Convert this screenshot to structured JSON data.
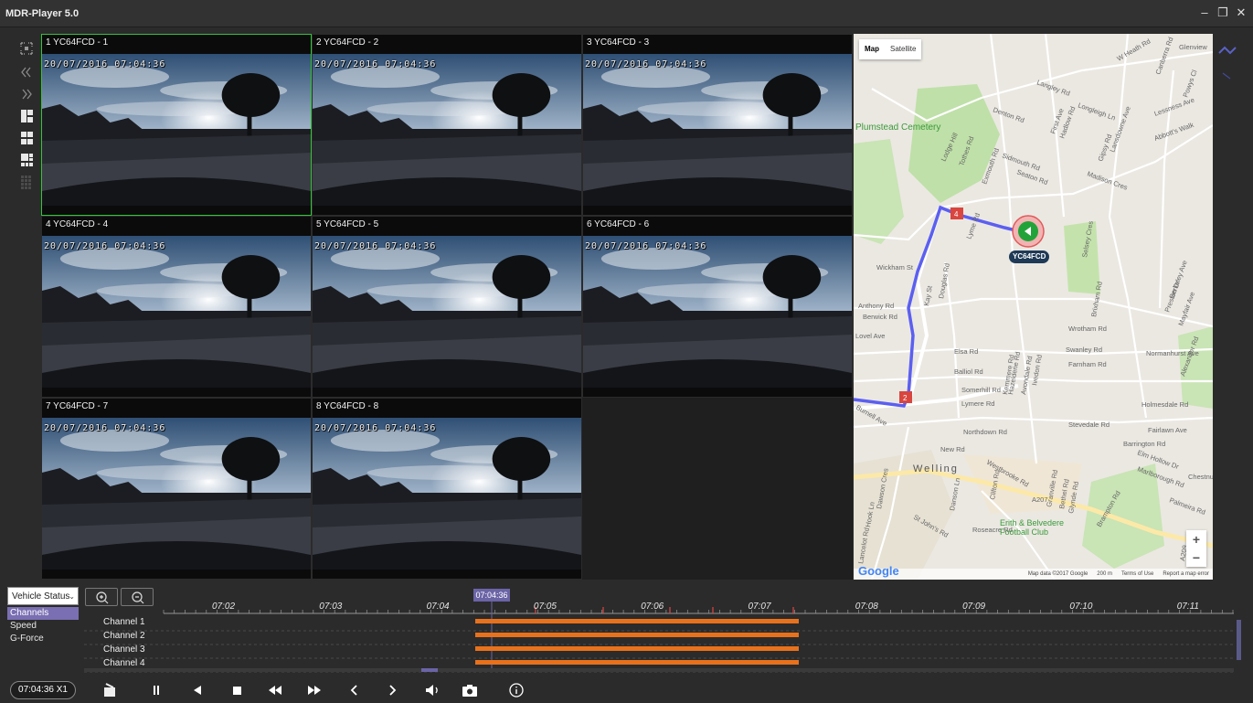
{
  "app": {
    "title": "MDR-Player 5.0",
    "window_controls": [
      "minimize",
      "restore",
      "close"
    ]
  },
  "left_toolbar": [
    "fullscreen-icon",
    "collapse-left-icon",
    "expand-right-icon",
    "layout-4-icon",
    "layout-4-alt-icon",
    "layout-9-icon",
    "layout-16-icon"
  ],
  "channels_grid": [
    {
      "caption": "1 YC64FCD - 1",
      "timestamp": "20/07/2016 07:04:36"
    },
    {
      "caption": "2 YC64FCD - 2",
      "timestamp": "20/07/2016 07:04:36"
    },
    {
      "caption": "3 YC64FCD - 3",
      "timestamp": "20/07/2016 07:04:36"
    },
    {
      "caption": "4 YC64FCD - 4",
      "timestamp": "20/07/2016 07:04:36"
    },
    {
      "caption": "5 YC64FCD - 5",
      "timestamp": "20/07/2016 07:04:36"
    },
    {
      "caption": "6 YC64FCD - 6",
      "timestamp": "20/07/2016 07:04:36"
    },
    {
      "caption": "7 YC64FCD - 7",
      "timestamp": "20/07/2016 07:04:36"
    },
    {
      "caption": "8 YC64FCD - 8",
      "timestamp": "20/07/2016 07:04:36"
    }
  ],
  "map": {
    "type_buttons": [
      "Map",
      "Satellite"
    ],
    "vehicle_label": "YC64FCD",
    "markers": [
      "4",
      "2"
    ],
    "places": {
      "cemetery": "Plumstead Cemetery",
      "welling": "Welling",
      "football": "Erith & Belvedere Football Club",
      "roads": [
        "Lodge Hill",
        "Wickham St",
        "Anthony Rd",
        "Berwick Rd",
        "Lovel Ave",
        "Elsa Rd",
        "Balliol Rd",
        "Somerhill Rd",
        "Lymere Rd",
        "Burnell Ave",
        "Northdown Rd",
        "New Rd",
        "Westbrooke Rd",
        "Wrotham Rd",
        "Swanley Rd",
        "Farnham Rd",
        "Stevedale Rd",
        "Fairlawn Ave",
        "Holmesdale Rd",
        "Barrington Rd",
        "Madison Cres",
        "Denton Rd",
        "Langley Rd",
        "Sidmouth Rd",
        "Seaton Rd",
        "Exmouth Rd",
        "Tothes Rd",
        "Lyme Rd",
        "Douglas Rd",
        "Kay St",
        "Clifton Rd",
        "Dawson Cres",
        "St John's Rd",
        "Danson Ln",
        "Roseacre Rd",
        "Granville Rd",
        "Bethel Rd",
        "Glynde Rd",
        "Palmeira Rd",
        "Marlborough Rd",
        "Elm Hollow Dr",
        "Brampton Rd",
        "A207",
        "Preston Dr",
        "Berkeley Ave",
        "Mayfair Ave",
        "Normanhurst Ave",
        "Alexander Rd",
        "Selsey Cres",
        "Brixham Rd",
        "Gipsy Rd",
        "Lansdowne Ave",
        "First Ave",
        "Hadlow Rd",
        "Longleigh Ln",
        "W Heath Rd",
        "Canberra Rd",
        "Lessness Ave",
        "Abbott's Walk",
        "Powys Cl",
        "Glenview",
        "Chestnut",
        "Hook Ln",
        "Lancelot Rd",
        "Kemmere Rd",
        "Hazeldene Rd",
        "Avondale Rd",
        "Ivedon Rd",
        "A209"
      ]
    },
    "zoom": [
      "+",
      "−"
    ],
    "footer": {
      "data": "Map data ©2017 Google",
      "scale": "200 m",
      "terms": "Terms of Use",
      "report": "Report a map error"
    },
    "google": "Google"
  },
  "bottom_panel": {
    "selector": "Vehicle Status",
    "side_list": [
      {
        "label": "Channels",
        "selected": true
      },
      {
        "label": "Speed",
        "selected": false
      },
      {
        "label": "G-Force",
        "selected": false
      }
    ],
    "current_time": "07:04:36",
    "ticks": [
      "07:02",
      "07:03",
      "07:04",
      "07:05",
      "07:06",
      "07:07",
      "07:08",
      "07:09",
      "07:10",
      "07:11"
    ],
    "channels": [
      "Channel 1",
      "Channel 2",
      "Channel 3",
      "Channel 4"
    ],
    "recording_color": "#e8711c",
    "accent": "#6b64a6"
  },
  "controls": {
    "time_display": "07:04:36  X1",
    "buttons": [
      "clip-icon",
      "pause-icon",
      "prev-frame-icon",
      "stop-icon",
      "rewind-icon",
      "fast-forward-icon",
      "step-back-icon",
      "step-forward-icon",
      "volume-icon",
      "snapshot-icon",
      "info-icon"
    ]
  }
}
